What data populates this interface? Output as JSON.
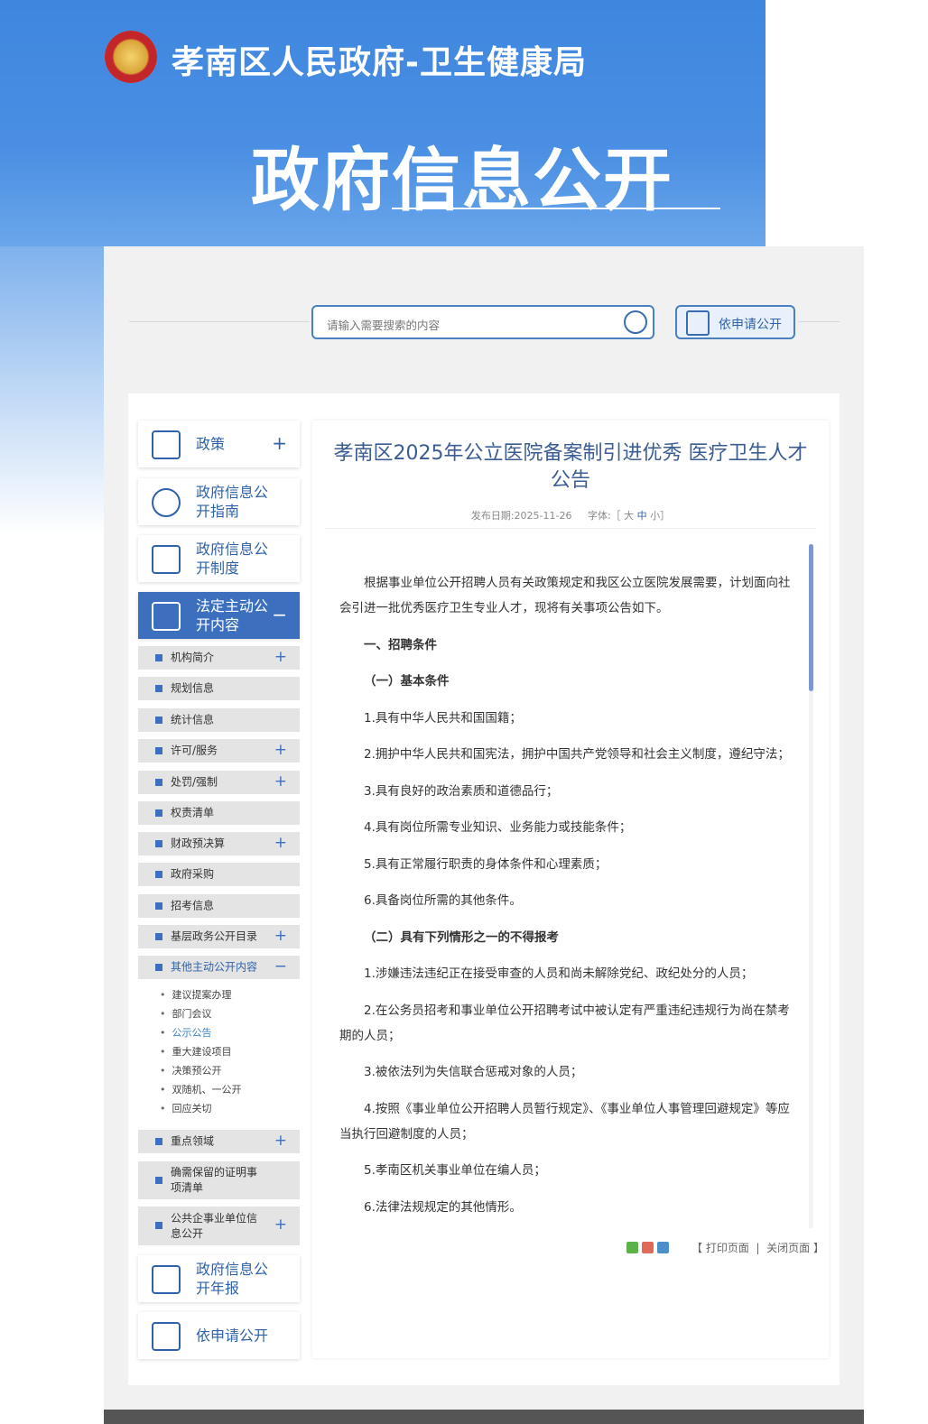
{
  "header": {
    "site_title": "孝南区人民政府-卫生健康局",
    "hero_title": "政府信息公开"
  },
  "search": {
    "placeholder": "请输入需要搜索的内容",
    "apply_label": "依申请公开"
  },
  "sidebar": {
    "top_items": [
      {
        "label": "政策",
        "toggle": "+"
      },
      {
        "label": "政府信息公开指南"
      },
      {
        "label": "政府信息公开制度"
      },
      {
        "label": "法定主动公开内容",
        "toggle": "−"
      }
    ],
    "items": [
      {
        "label": "机构简介",
        "toggle": "+"
      },
      {
        "label": "规划信息"
      },
      {
        "label": "统计信息"
      },
      {
        "label": "许可/服务",
        "toggle": "+"
      },
      {
        "label": "处罚/强制",
        "toggle": "+"
      },
      {
        "label": "权责清单"
      },
      {
        "label": "财政预决算",
        "toggle": "+"
      },
      {
        "label": "政府采购"
      },
      {
        "label": "招考信息"
      },
      {
        "label": "基层政务公开目录",
        "toggle": "+"
      },
      {
        "label": "其他主动公开内容",
        "toggle": "−"
      }
    ],
    "sub_items": [
      "建议提案办理",
      "部门会议",
      "公示公告",
      "重大建设项目",
      "决策预公开",
      "双随机、一公开",
      "回应关切"
    ],
    "items2": [
      {
        "label": "重点领域",
        "toggle": "+"
      },
      {
        "label": "确需保留的证明事项清单"
      },
      {
        "label": "公共企事业单位信息公开",
        "toggle": "+"
      }
    ],
    "bottom_items": [
      {
        "label": "政府信息公开年报"
      },
      {
        "label": "依申请公开"
      }
    ]
  },
  "article": {
    "title": "孝南区2025年公立医院备案制引进优秀 医疗卫生人才公告",
    "date": "发布日期:2025-11-26",
    "font_label": "字体:［",
    "font_large": "大",
    "font_medium": "中",
    "font_small": "小",
    "font_end": "］",
    "paragraphs": [
      "根据事业单位公开招聘人员有关政策规定和我区公立医院发展需要，计划面向社会引进一批优秀医疗卫生专业人才，现将有关事项公告如下。",
      "一、招聘条件",
      "（一）基本条件",
      "1.具有中华人民共和国国籍；",
      "2.拥护中华人民共和国宪法，拥护中国共产党领导和社会主义制度，遵纪守法；",
      "3.具有良好的政治素质和道德品行；",
      "4.具有岗位所需专业知识、业务能力或技能条件；",
      "5.具有正常履行职责的身体条件和心理素质；",
      "6.具备岗位所需的其他条件。",
      "（二）具有下列情形之一的不得报考",
      "1.涉嫌违法违纪正在接受审查的人员和尚未解除党纪、政纪处分的人员；",
      "2.在公务员招考和事业单位公开招聘考试中被认定有严重违纪违规行为尚在禁考期的人员；",
      "3.被依法列为失信联合惩戒对象的人员；",
      "4.按照《事业单位公开招聘人员暂行规定》、《事业单位人事管理回避规定》等应当执行回避制度的人员；",
      "5.孝南区机关事业单位在编人员；",
      "6.法律法规规定的其他情形。"
    ],
    "print_label": "【 打印页面",
    "sep": "|",
    "close_label": "关闭页面 】"
  }
}
